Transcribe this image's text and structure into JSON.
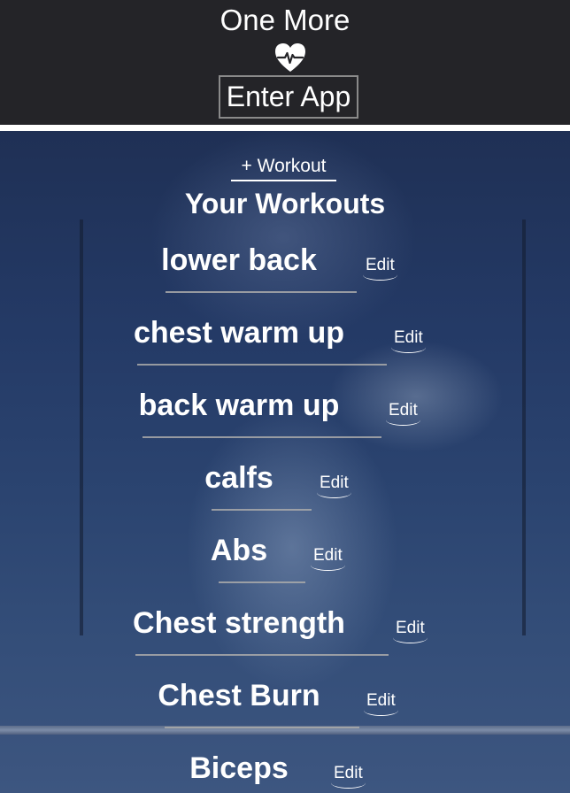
{
  "header": {
    "app_title": "One More",
    "enter_label": "Enter App"
  },
  "main": {
    "add_workout_label": "+ Workout",
    "section_title": "Your Workouts",
    "workouts": [
      {
        "name": "lower back",
        "edit_label": "Edit"
      },
      {
        "name": "chest warm up",
        "edit_label": "Edit"
      },
      {
        "name": "back warm up",
        "edit_label": "Edit"
      },
      {
        "name": "calfs",
        "edit_label": "Edit"
      },
      {
        "name": "Abs",
        "edit_label": "Edit"
      },
      {
        "name": "Chest strength",
        "edit_label": "Edit"
      },
      {
        "name": "Chest Burn",
        "edit_label": "Edit"
      },
      {
        "name": "Biceps",
        "edit_label": "Edit"
      }
    ]
  },
  "colors": {
    "header_bg": "#242428",
    "text": "#ffffff",
    "divider": "#aaaaaa"
  }
}
